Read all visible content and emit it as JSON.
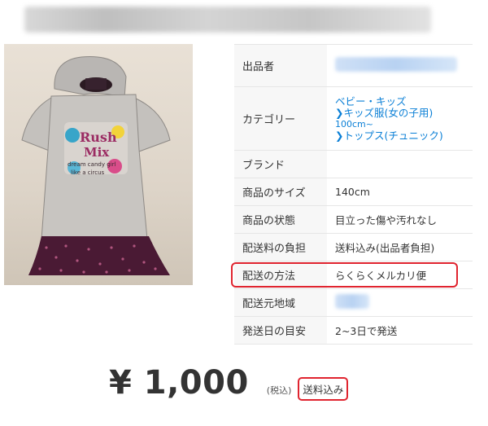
{
  "product": {
    "image_alt": "kids tunic photo",
    "image_text": [
      "Rush",
      "Mix",
      "dream candy girl",
      "like a circus"
    ]
  },
  "details": {
    "seller_label": "出品者",
    "category_label": "カテゴリー",
    "category_items": [
      "ベビー・キッズ",
      "キッズ服(女の子用)",
      "100cm~",
      "トップス(チュニック)"
    ],
    "brand_label": "ブランド",
    "brand_value": "",
    "size_label": "商品のサイズ",
    "size_value": "140cm",
    "condition_label": "商品の状態",
    "condition_value": "目立った傷や汚れなし",
    "shipping_fee_label": "配送料の負担",
    "shipping_fee_value": "送料込み(出品者負担)",
    "shipping_method_label": "配送の方法",
    "shipping_method_value": "らくらくメルカリ便",
    "ship_from_label": "配送元地域",
    "ship_days_label": "発送日の目安",
    "ship_days_value": "2~3日で発送"
  },
  "price": {
    "amount": "¥ 1,000",
    "tax_note": "(税込)",
    "shipping_note": "送料込み"
  },
  "colors": {
    "link": "#0a7fd6",
    "highlight": "#e0242f"
  }
}
